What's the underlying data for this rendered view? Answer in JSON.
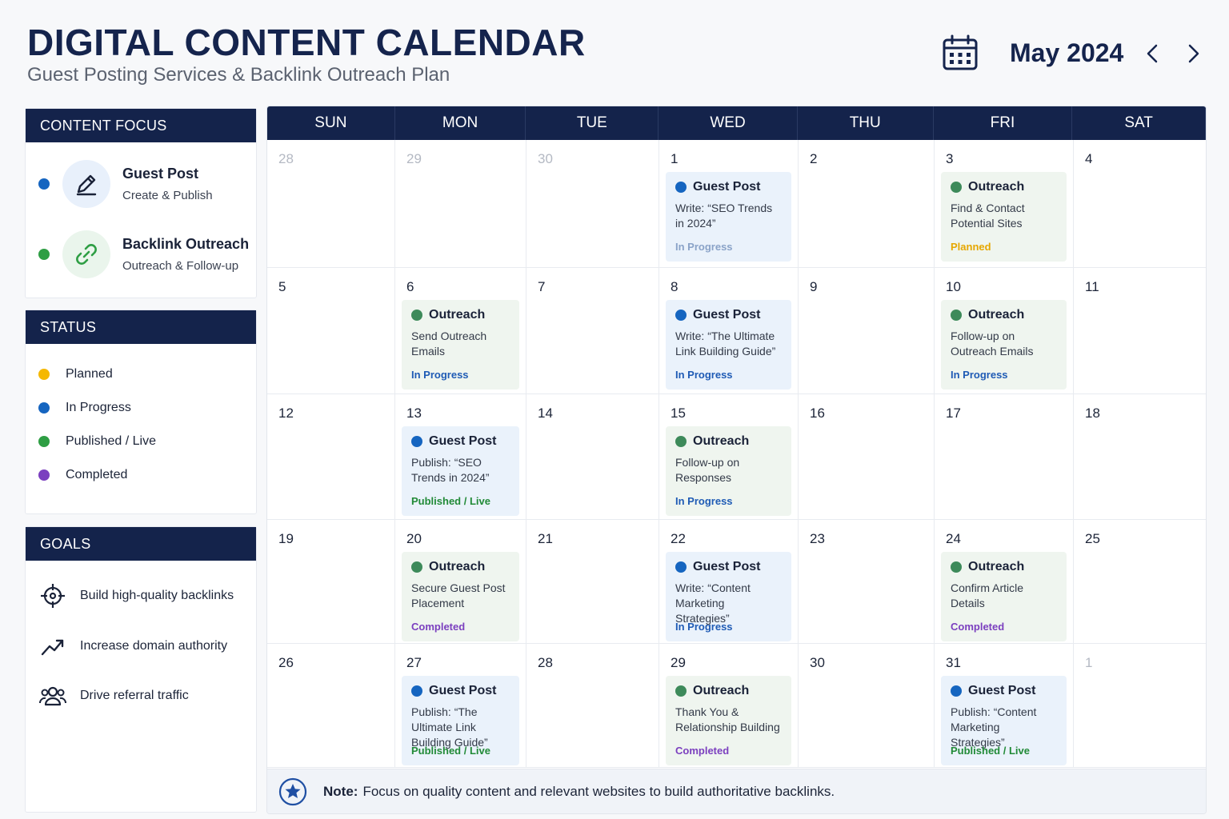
{
  "header": {
    "title": "DIGITAL CONTENT CALENDAR",
    "subtitle": "Guest Posting Services & Backlink Outreach Plan",
    "month": "May 2024",
    "icons": {
      "calendar": "calendar-icon",
      "prev": "chevron-left-icon",
      "next": "chevron-right-icon"
    }
  },
  "content_focus": {
    "heading": "CONTENT FOCUS",
    "items": [
      {
        "title": "Guest Post",
        "subtitle": "Create & Publish",
        "color": "#1565c0",
        "icon": "pen-edit-icon"
      },
      {
        "title": "Backlink Outreach",
        "subtitle": "Outreach & Follow-up",
        "color": "#2e9e44",
        "icon": "link-icon"
      }
    ]
  },
  "status_legend": {
    "heading": "STATUS",
    "items": [
      {
        "label": "Planned",
        "color": "#f5b800"
      },
      {
        "label": "In Progress",
        "color": "#1565c0"
      },
      {
        "label": "Published / Live",
        "color": "#2e9e44"
      },
      {
        "label": "Completed",
        "color": "#7b3fbf"
      }
    ]
  },
  "goals": {
    "heading": "GOALS",
    "items": [
      {
        "label": "Build high-quality backlinks",
        "icon": "target-icon"
      },
      {
        "label": "Increase domain authority",
        "icon": "trend-up-icon"
      },
      {
        "label": "Drive referral traffic",
        "icon": "users-icon"
      }
    ]
  },
  "calendar": {
    "day_names": [
      "SUN",
      "MON",
      "TUE",
      "WED",
      "THU",
      "FRI",
      "SAT"
    ],
    "weeks": [
      [
        {
          "day": "28",
          "muted": true
        },
        {
          "day": "29",
          "muted": true
        },
        {
          "day": "30",
          "muted": true
        },
        {
          "day": "1",
          "event": {
            "kind": "guest",
            "type": "Guest Post",
            "desc": "Write: “SEO Trends in 2024”",
            "status": "In Progress",
            "status_color": "#8aa3c8"
          }
        },
        {
          "day": "2"
        },
        {
          "day": "3",
          "event": {
            "kind": "outreach",
            "type": "Outreach",
            "desc": "Find & Contact Potential Sites",
            "status": "Planned",
            "status_color": "#e6a700"
          }
        },
        {
          "day": "4"
        }
      ],
      [
        {
          "day": "5"
        },
        {
          "day": "6",
          "event": {
            "kind": "outreach",
            "type": "Outreach",
            "desc": "Send Outreach Emails",
            "status": "In Progress",
            "status_color": "#1f5bb5"
          }
        },
        {
          "day": "7"
        },
        {
          "day": "8",
          "event": {
            "kind": "guest",
            "type": "Guest Post",
            "desc": "Write: “The Ultimate Link Building Guide”",
            "status": "In Progress",
            "status_color": "#1f5bb5"
          }
        },
        {
          "day": "9"
        },
        {
          "day": "10",
          "event": {
            "kind": "outreach",
            "type": "Outreach",
            "desc": "Follow-up on Outreach Emails",
            "status": "In Progress",
            "status_color": "#1f5bb5"
          }
        },
        {
          "day": "11"
        }
      ],
      [
        {
          "day": "12"
        },
        {
          "day": "13",
          "event": {
            "kind": "guest",
            "type": "Guest Post",
            "desc": "Publish: “SEO Trends in 2024”",
            "status": "Published / Live",
            "status_color": "#218a37"
          }
        },
        {
          "day": "14"
        },
        {
          "day": "15",
          "event": {
            "kind": "outreach",
            "type": "Outreach",
            "desc": "Follow-up on Responses",
            "status": "In Progress",
            "status_color": "#1f5bb5"
          }
        },
        {
          "day": "16"
        },
        {
          "day": "17"
        },
        {
          "day": "18"
        }
      ],
      [
        {
          "day": "19"
        },
        {
          "day": "20",
          "event": {
            "kind": "outreach",
            "type": "Outreach",
            "desc": "Secure Guest Post Placement",
            "status": "Completed",
            "status_color": "#7b3fbf"
          }
        },
        {
          "day": "21"
        },
        {
          "day": "22",
          "event": {
            "kind": "guest",
            "type": "Guest Post",
            "desc": "Write: “Content Marketing Strategies”",
            "status": "In Progress",
            "status_color": "#1f5bb5"
          }
        },
        {
          "day": "23"
        },
        {
          "day": "24",
          "event": {
            "kind": "outreach",
            "type": "Outreach",
            "desc": "Confirm Article Details",
            "status": "Completed",
            "status_color": "#7b3fbf"
          }
        },
        {
          "day": "25"
        }
      ],
      [
        {
          "day": "26"
        },
        {
          "day": "27",
          "event": {
            "kind": "guest",
            "type": "Guest Post",
            "desc": "Publish: “The Ultimate Link Building Guide”",
            "status": "Published / Live",
            "status_color": "#218a37"
          }
        },
        {
          "day": "28"
        },
        {
          "day": "29",
          "event": {
            "kind": "outreach",
            "type": "Outreach",
            "desc": "Thank You & Relationship Building",
            "status": "Completed",
            "status_color": "#7b3fbf"
          }
        },
        {
          "day": "30"
        },
        {
          "day": "31",
          "event": {
            "kind": "guest",
            "type": "Guest Post",
            "desc": "Publish: “Content Marketing Strategies”",
            "status": "Published / Live",
            "status_color": "#218a37"
          }
        },
        {
          "day": "1",
          "muted": true
        }
      ]
    ],
    "event_colors": {
      "guest": "#1565c0",
      "outreach": "#3d8a5a"
    }
  },
  "note": {
    "label": "Note:",
    "text": "Focus on quality content and relevant websites to build authoritative backlinks.",
    "icon": "star-badge-icon"
  }
}
